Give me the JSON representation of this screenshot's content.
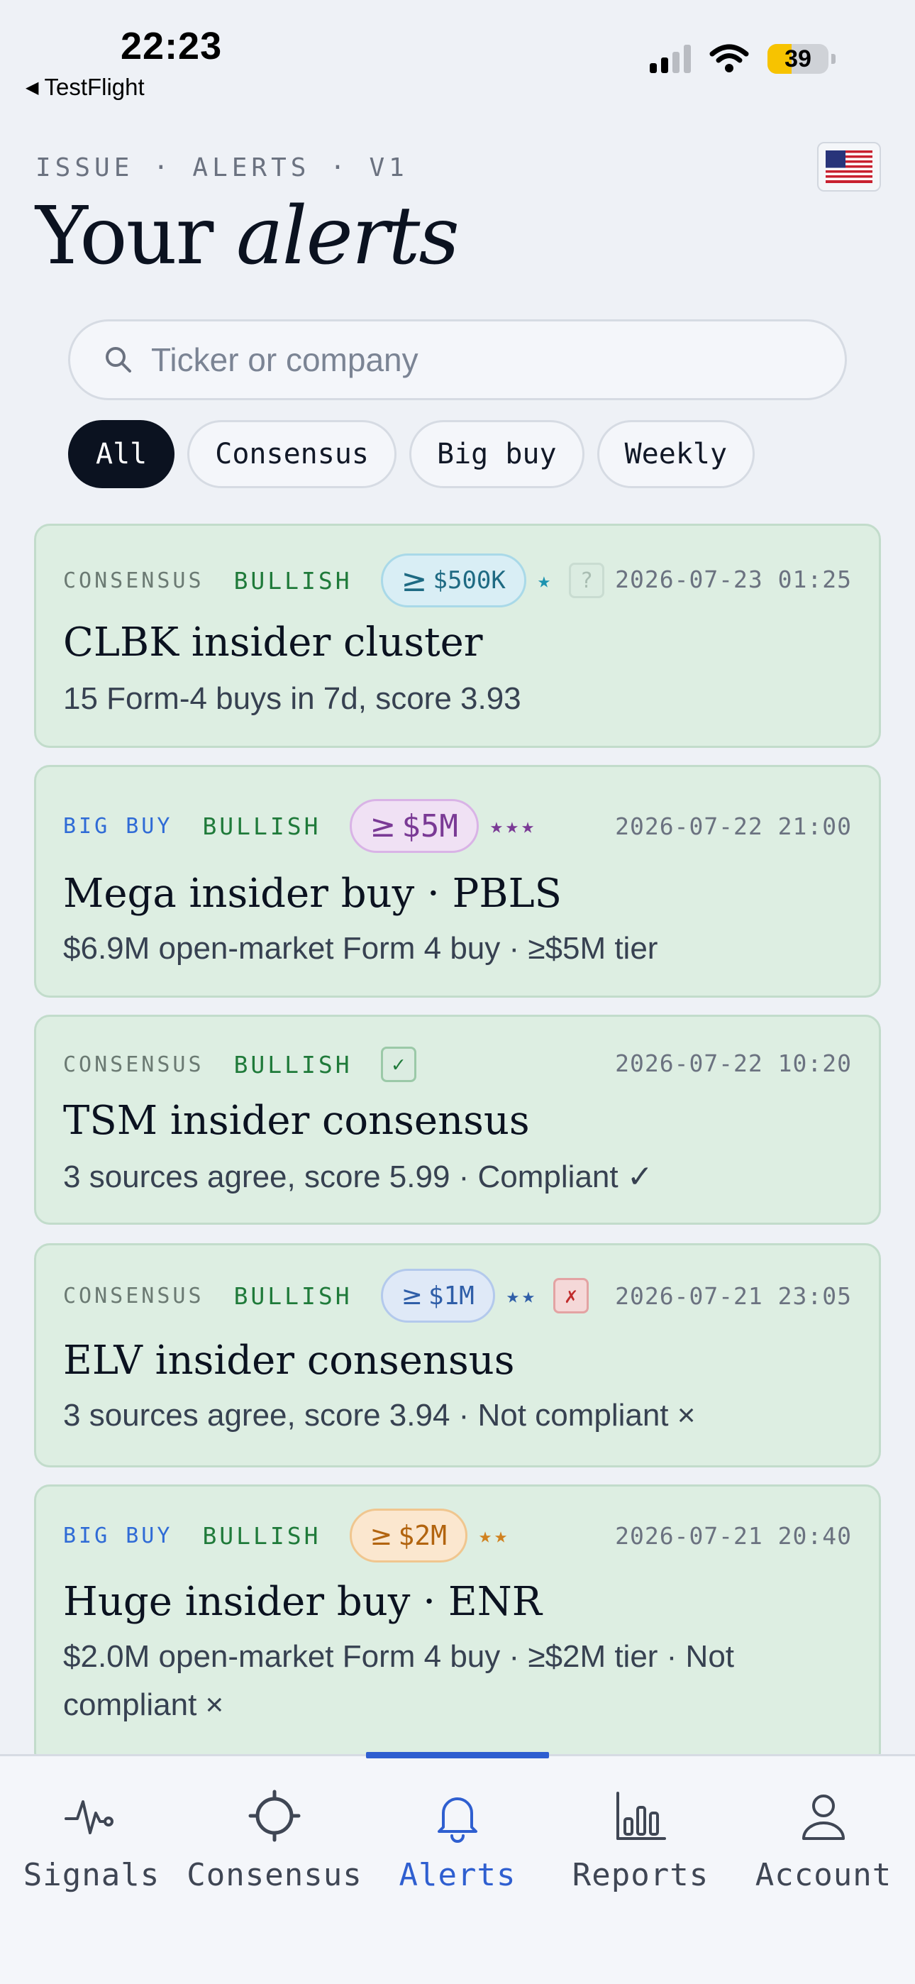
{
  "status_bar": {
    "time": "22:23",
    "back_app": "TestFlight",
    "battery": "39",
    "battery_level": 0.39
  },
  "header": {
    "kicker": "ISSUE · ALERTS · V1",
    "title_plain": "Your ",
    "title_italic": "alerts",
    "flag_icon": "us-flag-icon"
  },
  "search": {
    "placeholder": "Ticker or company",
    "value": ""
  },
  "filters": [
    {
      "label": "All",
      "active": true
    },
    {
      "label": "Consensus",
      "active": false
    },
    {
      "label": "Big buy",
      "active": false
    },
    {
      "label": "Weekly",
      "active": false
    }
  ],
  "alerts": [
    {
      "type": "CONSENSUS",
      "sentiment": "BULLISH",
      "tier": "$500K",
      "stars": "★",
      "compliance": "?",
      "time": "2026-07-23 01:25",
      "title": "CLBK insider cluster",
      "subtitle": "15 Form-4 buys in 7d, score 3.93"
    },
    {
      "type": "BIG BUY",
      "sentiment": "BULLISH",
      "tier": "$5M",
      "stars": "★★★",
      "compliance": "",
      "time": "2026-07-22 21:00",
      "title": "Mega insider buy · PBLS",
      "subtitle": "$6.9M open-market Form 4 buy · ≥$5M tier"
    },
    {
      "type": "CONSENSUS",
      "sentiment": "BULLISH",
      "tier": "",
      "stars": "",
      "compliance": "✓",
      "time": "2026-07-22 10:20",
      "title": "TSM insider consensus",
      "subtitle": "3 sources agree, score 5.99 · Compliant ✓"
    },
    {
      "type": "CONSENSUS",
      "sentiment": "BULLISH",
      "tier": "$1M",
      "stars": "★★",
      "compliance": "✗",
      "time": "2026-07-21 23:05",
      "title": "ELV insider consensus",
      "subtitle": "3 sources agree, score 3.94 · Not compliant ×"
    },
    {
      "type": "BIG BUY",
      "sentiment": "BULLISH",
      "tier": "$2M",
      "stars": "★★",
      "compliance": "",
      "time": "2026-07-21 20:40",
      "title": "Huge insider buy · ENR",
      "subtitle": "$2.0M open-market Form 4 buy · ≥$2M tier · Not compliant ×"
    }
  ],
  "tier_prefix": "≥",
  "tabs": [
    {
      "label": "Signals",
      "icon": "pulse-icon",
      "active": false
    },
    {
      "label": "Consensus",
      "icon": "crosshair-icon",
      "active": false
    },
    {
      "label": "Alerts",
      "icon": "bell-icon",
      "active": true
    },
    {
      "label": "Reports",
      "icon": "bar-chart-icon",
      "active": false
    },
    {
      "label": "Account",
      "icon": "user-icon",
      "active": false
    }
  ],
  "colors": {
    "accent": "#2f5fd0",
    "card_bg": "#ddeee2",
    "bullish": "#1f7a3a",
    "big_buy": "#2f6bd6"
  }
}
